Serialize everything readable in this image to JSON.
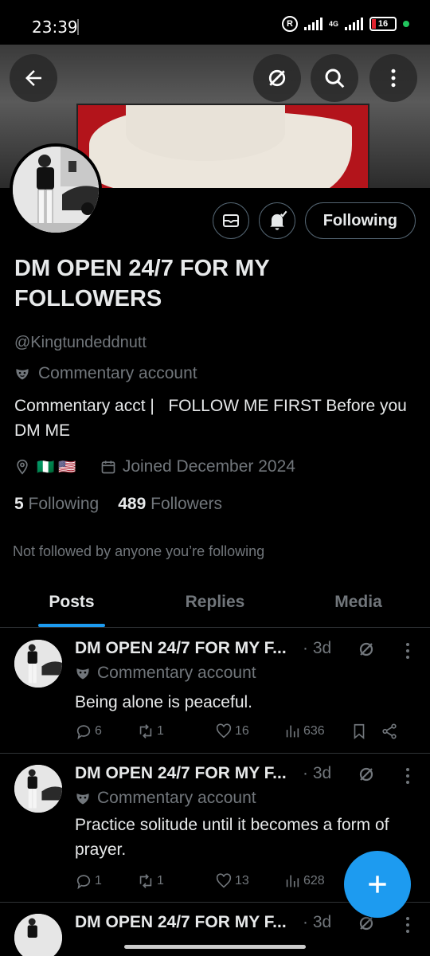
{
  "status": {
    "time": "23:39",
    "network": "4G",
    "battery": "16",
    "accent_dot": "#22c55e"
  },
  "header": {
    "back_icon": "arrow-left-icon",
    "grok_icon": "grok-icon",
    "search_icon": "search-icon",
    "more_icon": "more-vertical-icon"
  },
  "profile": {
    "display_name": "DM OPEN 24/7 FOR MY FOLLOWERS",
    "handle": "@Kingtundeddnutt",
    "label": "Commentary account",
    "bio": "Commentary acct |   FOLLOW ME FIRST Before you DM ME",
    "location_flags": "🇳🇬 🇺🇸",
    "joined": "Joined December 2024",
    "following_count": "5",
    "following_label": "Following",
    "followers_count": "489",
    "followers_label": "Followers",
    "not_followed": "Not followed by anyone you’re following",
    "follow_button": "Following"
  },
  "tabs": [
    {
      "label": "Posts",
      "active": true
    },
    {
      "label": "Replies",
      "active": false
    },
    {
      "label": "Media",
      "active": false
    }
  ],
  "posts": [
    {
      "name": "DM OPEN 24/7 FOR MY F...",
      "time": "· 3d",
      "label": "Commentary account",
      "text": "Being alone is peaceful.",
      "replies": "6",
      "reposts": "1",
      "likes": "16",
      "views": "636"
    },
    {
      "name": "DM OPEN 24/7 FOR MY F...",
      "time": "· 3d",
      "label": "Commentary account",
      "text": "Practice solitude until it becomes a form of prayer.",
      "replies": "1",
      "reposts": "1",
      "likes": "13",
      "views": "628"
    },
    {
      "name": "DM OPEN 24/7 FOR MY F...",
      "time": "· 3d"
    }
  ],
  "colors": {
    "accent": "#1d9bf0",
    "muted": "#71767b",
    "text": "#e7e9ea",
    "background": "#000000"
  }
}
